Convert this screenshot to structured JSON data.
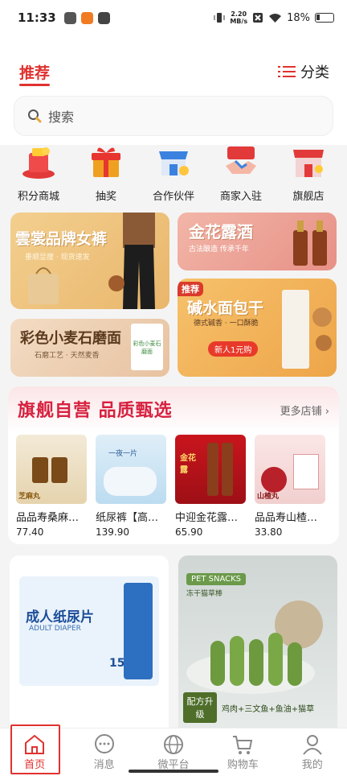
{
  "status_bar": {
    "time": "11:33",
    "net_speed_value": "2.20",
    "net_speed_unit": "MB/s",
    "battery": "18%"
  },
  "header": {
    "tab_recommend": "推荐",
    "category": "分类"
  },
  "search": {
    "placeholder": "搜索"
  },
  "quick_nav": [
    {
      "label": "积分商城",
      "icon": "points-mall-icon"
    },
    {
      "label": "抽奖",
      "icon": "gift-box-icon"
    },
    {
      "label": "合作伙伴",
      "icon": "store-icon"
    },
    {
      "label": "商家入驻",
      "icon": "handshake-icon"
    },
    {
      "label": "旗舰店",
      "icon": "flagship-store-icon"
    }
  ],
  "banners": {
    "b1_title": "雲裳品牌女裤",
    "b1_sub": "垂顺显瘦 · 现货速发",
    "b2_title": "彩色小麦石磨面",
    "b2_sub": "石磨工艺 · 天然麦香",
    "b2_pack": "彩色小麦石磨面",
    "b3_title": "金花露酒",
    "b3_sub": "古法酿造 传承千年",
    "b4_tag": "推荐",
    "b4_title": "碱水面包干",
    "b4_sub": "德式碱香 · 一口酥脆",
    "b4_btn": "新人1元购"
  },
  "flagship": {
    "title": "旗舰自营  品质甄选",
    "more": "更多店铺 ›",
    "items": [
      {
        "name": "品品寿桑麻…",
        "price": "77.40",
        "img_label": "芝麻丸"
      },
      {
        "name": "纸尿裤【高…",
        "price": "139.90",
        "img_label": "一夜一片"
      },
      {
        "name": "中迎金花露…",
        "price": "65.90",
        "img_label": "金花露"
      },
      {
        "name": "品品寿山楂…",
        "price": "33.80",
        "img_label": "山楂丸"
      }
    ]
  },
  "cards": {
    "c1_title": "成人纸尿片",
    "c1_sub": "ADULT DIAPER",
    "c1_count": "15",
    "c2_title": "PET SNACKS",
    "c2_sub": "冻干猫草棒",
    "c2_badge": "配方升级",
    "c2_desc": "鸡肉+三文鱼+鱼油+猫草"
  },
  "tabbar": [
    {
      "label": "首页",
      "icon": "home-icon"
    },
    {
      "label": "消息",
      "icon": "message-icon"
    },
    {
      "label": "微平台",
      "icon": "globe-icon"
    },
    {
      "label": "购物车",
      "icon": "cart-icon"
    },
    {
      "label": "我的",
      "icon": "profile-icon"
    }
  ],
  "colors": {
    "accent": "#e0322f",
    "flagship_title": "#d6213f"
  }
}
